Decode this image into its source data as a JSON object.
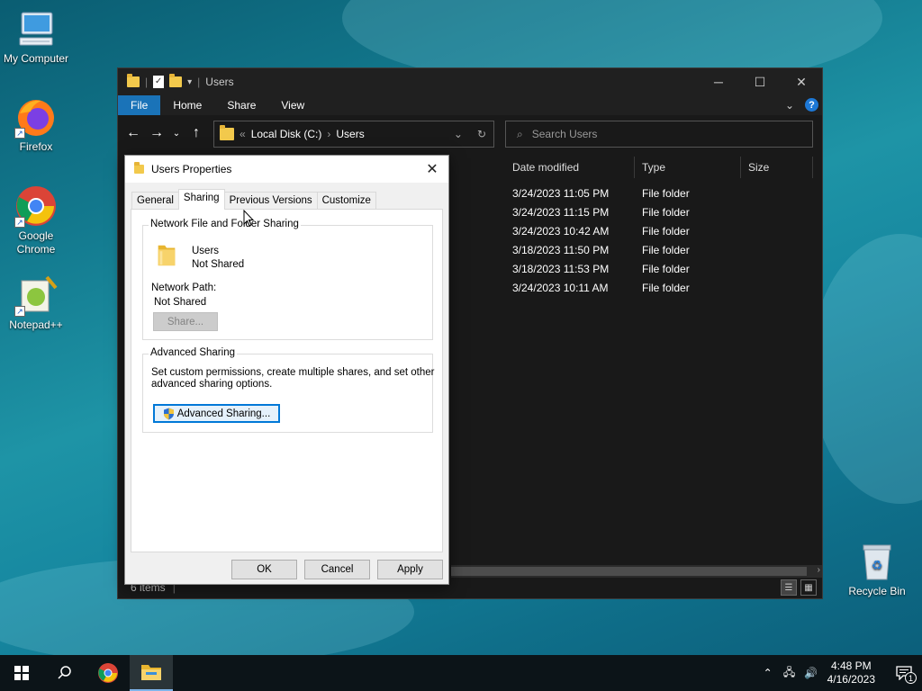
{
  "desktop": {
    "icons": [
      {
        "label": "My Computer"
      },
      {
        "label": "Firefox"
      },
      {
        "label": "Google Chrome"
      },
      {
        "label": "Notepad++"
      },
      {
        "label": "Recycle Bin"
      }
    ]
  },
  "explorer": {
    "title": "Users",
    "ribbon_tabs": [
      "File",
      "Home",
      "Share",
      "View"
    ],
    "breadcrumb": [
      "Local Disk (C:)",
      "Users"
    ],
    "search_placeholder": "Search Users",
    "columns": [
      "Date modified",
      "Type",
      "Size"
    ],
    "rows": [
      {
        "date": "3/24/2023 11:05 PM",
        "type": "File folder"
      },
      {
        "date": "3/24/2023 11:15 PM",
        "type": "File folder"
      },
      {
        "date": "3/24/2023 10:42 AM",
        "type": "File folder"
      },
      {
        "date": "3/18/2023 11:50 PM",
        "type": "File folder"
      },
      {
        "date": "3/18/2023 11:53 PM",
        "type": "File folder"
      },
      {
        "date": "3/24/2023 10:11 AM",
        "type": "File folder"
      }
    ],
    "status": "6 items"
  },
  "dialog": {
    "title": "Users Properties",
    "tabs": [
      "General",
      "Sharing",
      "Previous Versions",
      "Customize"
    ],
    "active_tab": "Sharing",
    "network_group": {
      "legend": "Network File and Folder Sharing",
      "name": "Users",
      "state": "Not Shared",
      "path_label": "Network Path:",
      "path_value": "Not Shared",
      "share_button": "Share..."
    },
    "advanced_group": {
      "legend": "Advanced Sharing",
      "description_line1": "Set custom permissions, create multiple shares, and set other",
      "description_line2": "advanced sharing options.",
      "button": "Advanced Sharing..."
    },
    "buttons": {
      "ok": "OK",
      "cancel": "Cancel",
      "apply": "Apply"
    }
  },
  "taskbar": {
    "time": "4:48 PM",
    "date": "4/16/2023",
    "notification_count": "1"
  }
}
